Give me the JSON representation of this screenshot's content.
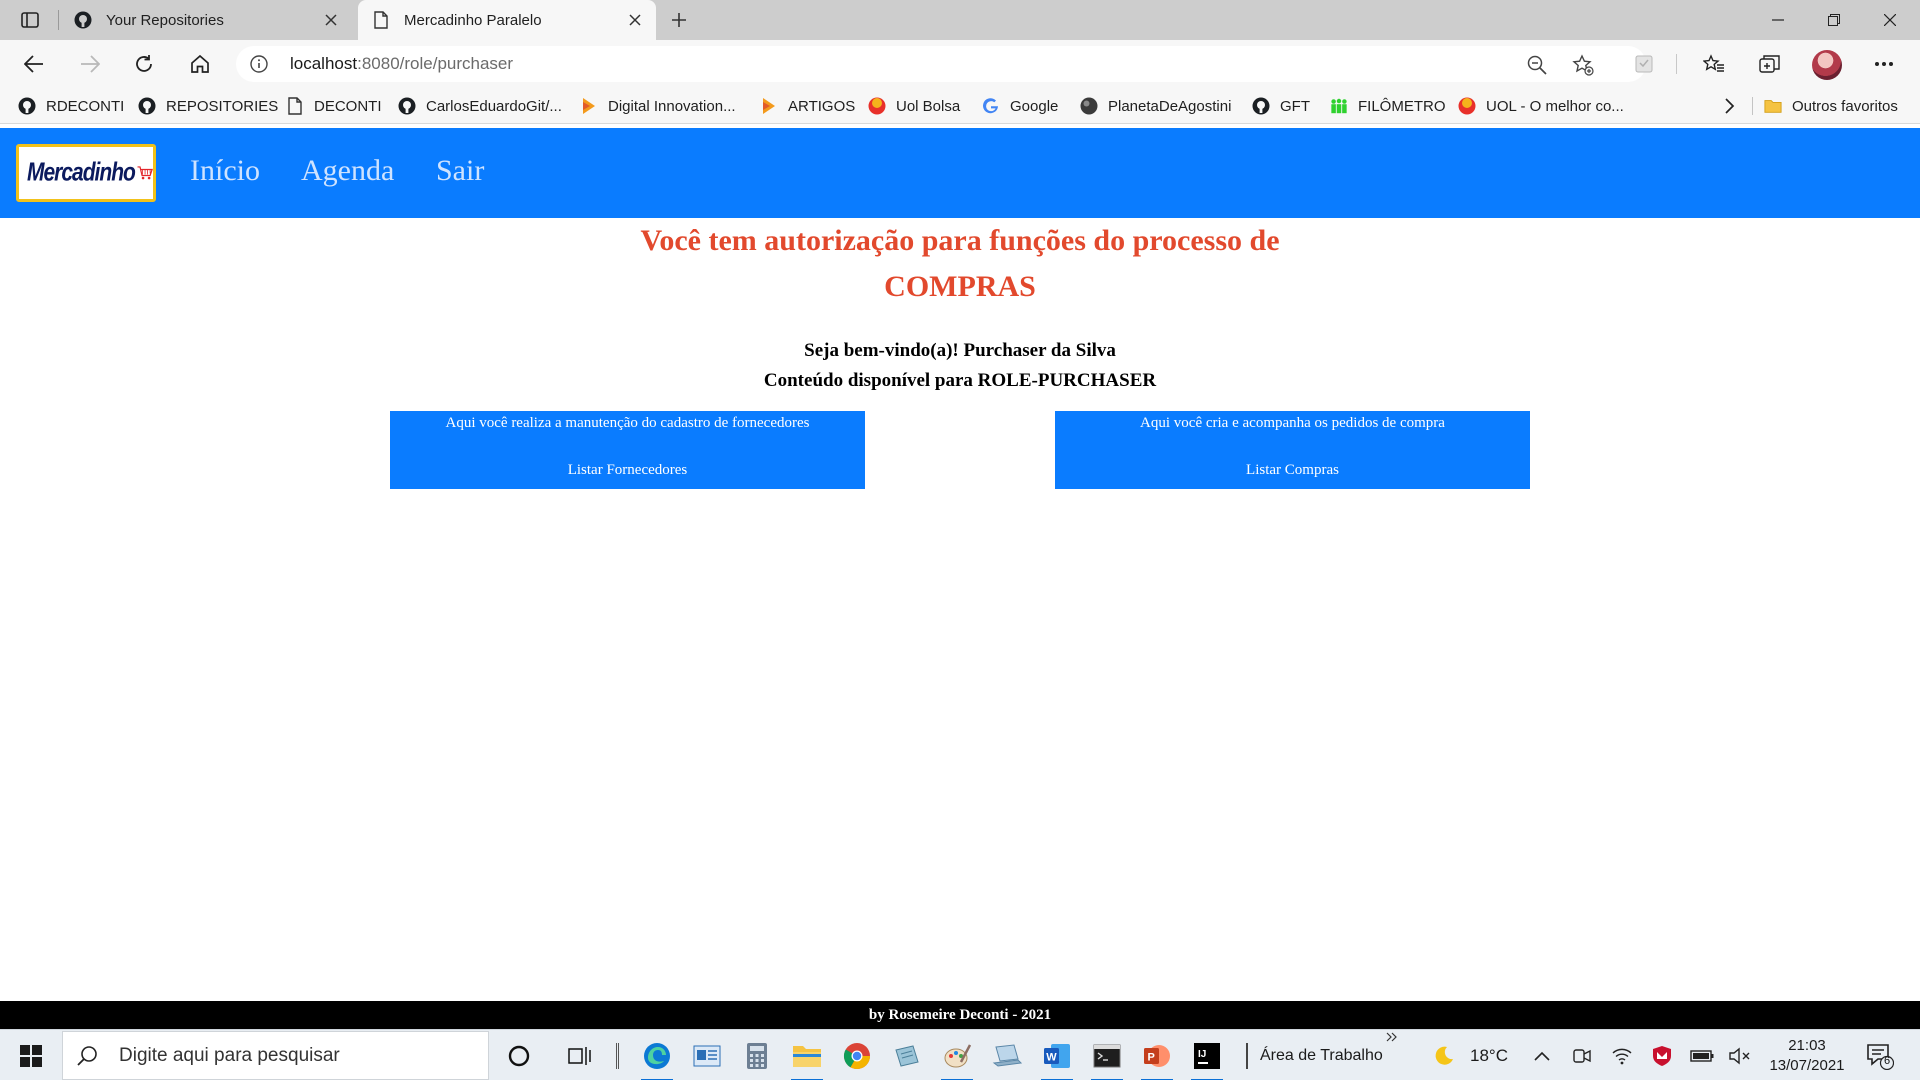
{
  "browser": {
    "tabs": [
      {
        "title": "Your Repositories",
        "icon": "github-icon",
        "active": false
      },
      {
        "title": "Mercadinho Paralelo",
        "icon": "page-icon",
        "active": true
      }
    ],
    "url": {
      "host": "localhost",
      "path": ":8080/role/purchaser"
    },
    "bookmarks": [
      {
        "label": "RDECONTI",
        "icon": "github-icon"
      },
      {
        "label": "REPOSITORIES",
        "icon": "github-icon"
      },
      {
        "label": "DECONTI",
        "icon": "page-icon"
      },
      {
        "label": "CarlosEduardoGit/...",
        "icon": "github-icon"
      },
      {
        "label": "Digital Innovation...",
        "icon": "dio-icon"
      },
      {
        "label": "ARTIGOS",
        "icon": "dio-icon"
      },
      {
        "label": "Uol Bolsa",
        "icon": "uol-icon"
      },
      {
        "label": "Google",
        "icon": "google-icon"
      },
      {
        "label": "PlanetaDeAgostini",
        "icon": "globe-icon"
      },
      {
        "label": "GFT",
        "icon": "github-icon"
      },
      {
        "label": "FILÔMETRO",
        "icon": "people-icon"
      },
      {
        "label": "UOL - O melhor co...",
        "icon": "uol-icon"
      }
    ],
    "other_favorites": "Outros favoritos"
  },
  "site": {
    "logo_text": "Mercadinho",
    "nav": [
      "Início",
      "Agenda",
      "Sair"
    ],
    "title_line1": "Você tem autorização para funções do processo de",
    "title_line2": "COMPRAS",
    "welcome": "Seja bem-vindo(a)! Purchaser da Silva",
    "content_note": "Conteúdo disponível para ROLE-PURCHASER",
    "cards": [
      {
        "description": "Aqui você realiza a manutenção do cadastro de fornecedores",
        "action": "Listar Fornecedores"
      },
      {
        "description": "Aqui você cria e acompanha os pedidos de compra",
        "action": "Listar Compras"
      }
    ],
    "footer": "by Rosemeire Deconti - 2021",
    "colors": {
      "primary": "#0a7cff",
      "title": "#e2492d",
      "logo_border": "#f2c21a",
      "footer_bg": "#000000"
    }
  },
  "taskbar": {
    "search_placeholder": "Digite aqui para pesquisar",
    "desktop_label": "Área de Trabalho",
    "temperature": "18°C",
    "time": "21:03",
    "date": "13/07/2021",
    "notification_count": "6"
  }
}
